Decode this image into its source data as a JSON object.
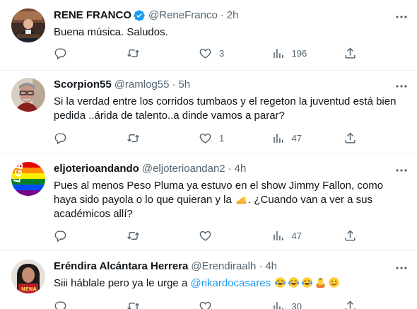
{
  "tweets": [
    {
      "name": "RENE FRANCO",
      "verified": true,
      "handle": "@ReneFranco",
      "time": "2h",
      "text": "Buena música. Saludos.",
      "replies": "",
      "retweets": "",
      "likes": "3",
      "views": "196",
      "avatar_icon": "avatar-photo-man-suit",
      "avatar_color": "#5b3a2e"
    },
    {
      "name": "Scorpion55",
      "verified": false,
      "handle": "@ramlog55",
      "time": "5h",
      "text": "Si la verdad entre los corridos tumbaos y el regeton la juventud está bien pedida ..árida de talento..a dinde vamos a parar?",
      "replies": "",
      "retweets": "",
      "likes": "1",
      "views": "47",
      "avatar_icon": "avatar-photo-man-glasses",
      "avatar_color": "#c9b9a8"
    },
    {
      "name": "eljoterioandando",
      "verified": false,
      "handle": "@eljoterioandan2",
      "time": "4h",
      "text_before_emoji": "Pues al menos Peso Pluma ya estuvo en el show Jimmy Fallon, como haya sido payola o lo que quieran y la ",
      "text_after_emoji": ". ¿Cuando van a ver a sus académicos allí?",
      "emoji_icon": "cheese-emoji-icon",
      "avatar_text": "LGBT",
      "replies": "",
      "retweets": "",
      "likes": "",
      "views": "47",
      "avatar_icon": "avatar-rainbow-lgbt"
    },
    {
      "name": "Eréndira Alcántara Herrera",
      "verified": false,
      "handle": "@Erendiraalh",
      "time": "4h",
      "text_before_mention": "Siii háblale pero ya le urge a ",
      "mention": "@rikardocasares",
      "emojis": [
        "tears-of-joy-emoji-icon",
        "tears-of-joy-emoji-icon",
        "tears-of-joy-emoji-icon",
        "person-bowing-emoji-icon",
        "smiling-face-emoji-icon"
      ],
      "avatar_text": "NENA",
      "replies": "",
      "retweets": "",
      "likes": "",
      "views": "30",
      "avatar_icon": "avatar-photo-woman"
    }
  ],
  "colors": {
    "text_primary": "#0f1419",
    "text_secondary": "#536471",
    "accent": "#1d9bf0",
    "divider": "#eff3f4"
  },
  "icons": {
    "reply": "reply-icon",
    "retweet": "retweet-icon",
    "like": "heart-icon",
    "views": "views-chart-icon",
    "share": "share-icon",
    "more": "more-dots-icon",
    "verified": "verified-badge-icon"
  }
}
